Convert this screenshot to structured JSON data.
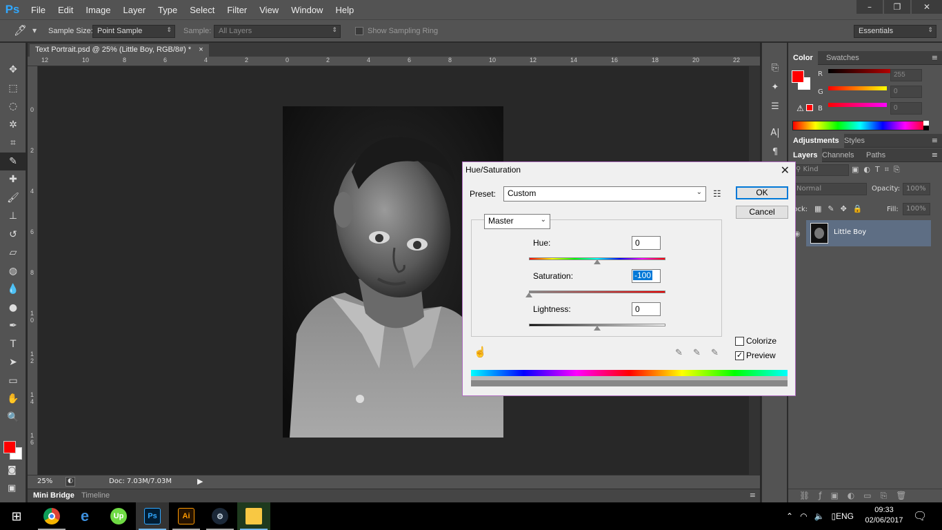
{
  "app": {
    "logo": "Ps"
  },
  "menu": [
    "File",
    "Edit",
    "Image",
    "Layer",
    "Type",
    "Select",
    "Filter",
    "View",
    "Window",
    "Help"
  ],
  "window_controls": [
    "–",
    "❐",
    "✕"
  ],
  "options_bar": {
    "sample_size_label": "Sample Size:",
    "sample_size_value": "Point Sample",
    "sample_label": "Sample:",
    "sample_value": "All Layers",
    "show_sampling_ring": "Show Sampling Ring",
    "workspace": "Essentials"
  },
  "document": {
    "tab_title": "Text Portrait.psd @ 25% (Little Boy, RGB/8#) *",
    "tab_close": "×",
    "ruler_h": [
      "12",
      "10",
      "8",
      "6",
      "4",
      "2",
      "0",
      "2",
      "4",
      "6",
      "8",
      "10",
      "12",
      "14",
      "16",
      "18",
      "20",
      "22"
    ],
    "ruler_v": [
      "0",
      "2",
      "4",
      "6",
      "8",
      "1 0",
      "1 2",
      "1 4",
      "1 6"
    ],
    "zoom": "25%",
    "doc_size": "Doc: 7.03M/7.03M"
  },
  "bottom_tabs": [
    "Mini Bridge",
    "Timeline"
  ],
  "color_panel": {
    "tabs": [
      "Color",
      "Swatches"
    ],
    "channels": [
      {
        "label": "R",
        "value": "255"
      },
      {
        "label": "G",
        "value": "0"
      },
      {
        "label": "B",
        "value": "0"
      }
    ],
    "foreground": "#ff0000",
    "background": "#ffffff"
  },
  "adjustments_panel": {
    "tabs": [
      "Adjustments",
      "Styles"
    ]
  },
  "layers_panel": {
    "tabs": [
      "Layers",
      "Channels",
      "Paths"
    ],
    "filter_kind": "Kind",
    "blend_mode": "Normal",
    "opacity_label": "Opacity:",
    "opacity_value": "100%",
    "lock_label": "Lock:",
    "fill_label": "Fill:",
    "fill_value": "100%",
    "layers": [
      {
        "name": "Little Boy"
      }
    ]
  },
  "dialog": {
    "title": "Hue/Saturation",
    "close": "✕",
    "preset_label": "Preset:",
    "preset_value": "Custom",
    "ok": "OK",
    "cancel": "Cancel",
    "channel": "Master",
    "hue_label": "Hue:",
    "hue_value": "0",
    "saturation_label": "Saturation:",
    "saturation_value": "-100",
    "lightness_label": "Lightness:",
    "lightness_value": "0",
    "colorize_label": "Colorize",
    "colorize_checked": false,
    "preview_label": "Preview",
    "preview_checked": true,
    "hue_position": 0.5,
    "saturation_position": 0.0,
    "lightness_position": 0.5
  },
  "taskbar": {
    "language": "ENG",
    "time": "09:33",
    "date": "02/06/2017",
    "apps": [
      "chrome",
      "edge",
      "upwork",
      "photoshop",
      "illustrator",
      "steam",
      "file-explorer"
    ]
  }
}
